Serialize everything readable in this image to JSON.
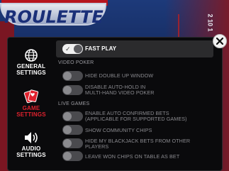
{
  "game": {
    "logo_text": "ROULETTE",
    "table_number": "2 10 1"
  },
  "sidebar": {
    "items": [
      {
        "label": "GENERAL\nSETTINGS",
        "icon": "globe-gear-icon",
        "active": false
      },
      {
        "label": "GAME\nSETTINGS",
        "icon": "cards-icon",
        "active": true
      },
      {
        "label": "AUDIO\nSETTINGS",
        "icon": "speaker-icon",
        "active": false
      }
    ]
  },
  "settings": {
    "fast_play": {
      "label": "FAST PLAY",
      "on": true
    },
    "video_poker": {
      "title": "VIDEO POKER",
      "items": [
        {
          "label": "HIDE DOUBLE UP WINDOW",
          "on": false
        },
        {
          "label": "DISABLE AUTO-HOLD IN\nMULTI-HAND VIDEO POKER",
          "on": false
        }
      ]
    },
    "live_games": {
      "title": "LIVE GAMES",
      "items": [
        {
          "label": "ENABLE AUTO CONFIRMED BETS\n(APPLICABLE FOR SUPPORTED GAMES)",
          "on": false
        },
        {
          "label": "SHOW COMMUNITY CHIPS",
          "on": false
        },
        {
          "label": "HIDE MY BLACKJACK BETS FROM OTHER\nPLAYERS",
          "on": false
        },
        {
          "label": "LEAVE WON CHIPS ON TABLE AS BET",
          "on": false
        }
      ]
    }
  },
  "colors": {
    "active_red": "#e0222e",
    "panel_bg": "#0a0a0c"
  },
  "icons": {
    "close": "close-icon",
    "toggle_check": "✓"
  }
}
